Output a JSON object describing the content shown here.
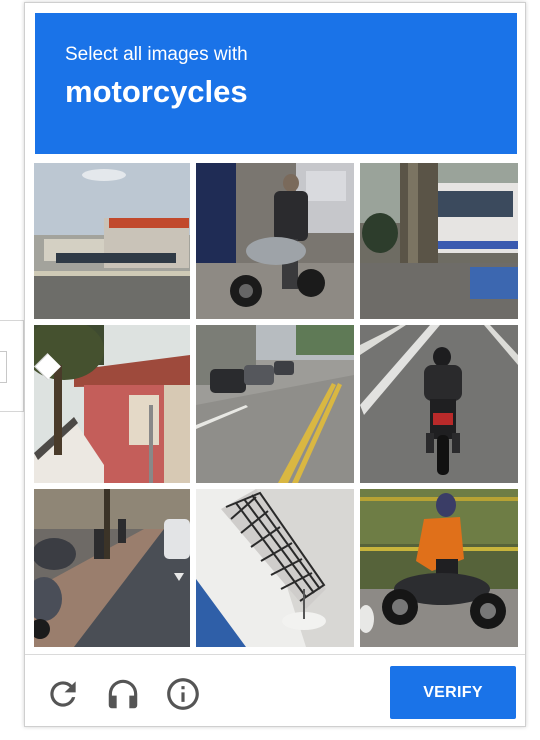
{
  "challenge": {
    "instruction": "Select all images with",
    "target": "motorcycles"
  },
  "colors": {
    "accent": "#1a73e8",
    "icon": "#555555"
  },
  "tiles": [
    {
      "name": "tile-1",
      "depicts": "street building"
    },
    {
      "name": "tile-2",
      "depicts": "motorcycle rider"
    },
    {
      "name": "tile-3",
      "depicts": "bus and tree"
    },
    {
      "name": "tile-4",
      "depicts": "red house and tree"
    },
    {
      "name": "tile-5",
      "depicts": "road with cars"
    },
    {
      "name": "tile-6",
      "depicts": "motorcycle rider on road"
    },
    {
      "name": "tile-7",
      "depicts": "sidewalk parked scooters"
    },
    {
      "name": "tile-8",
      "depicts": "balcony railing"
    },
    {
      "name": "tile-9",
      "depicts": "motorcycle rider orange jacket"
    }
  ],
  "footer": {
    "icons": [
      "reload-icon",
      "headphones-icon",
      "info-icon"
    ],
    "verify_label": "VERIFY"
  }
}
